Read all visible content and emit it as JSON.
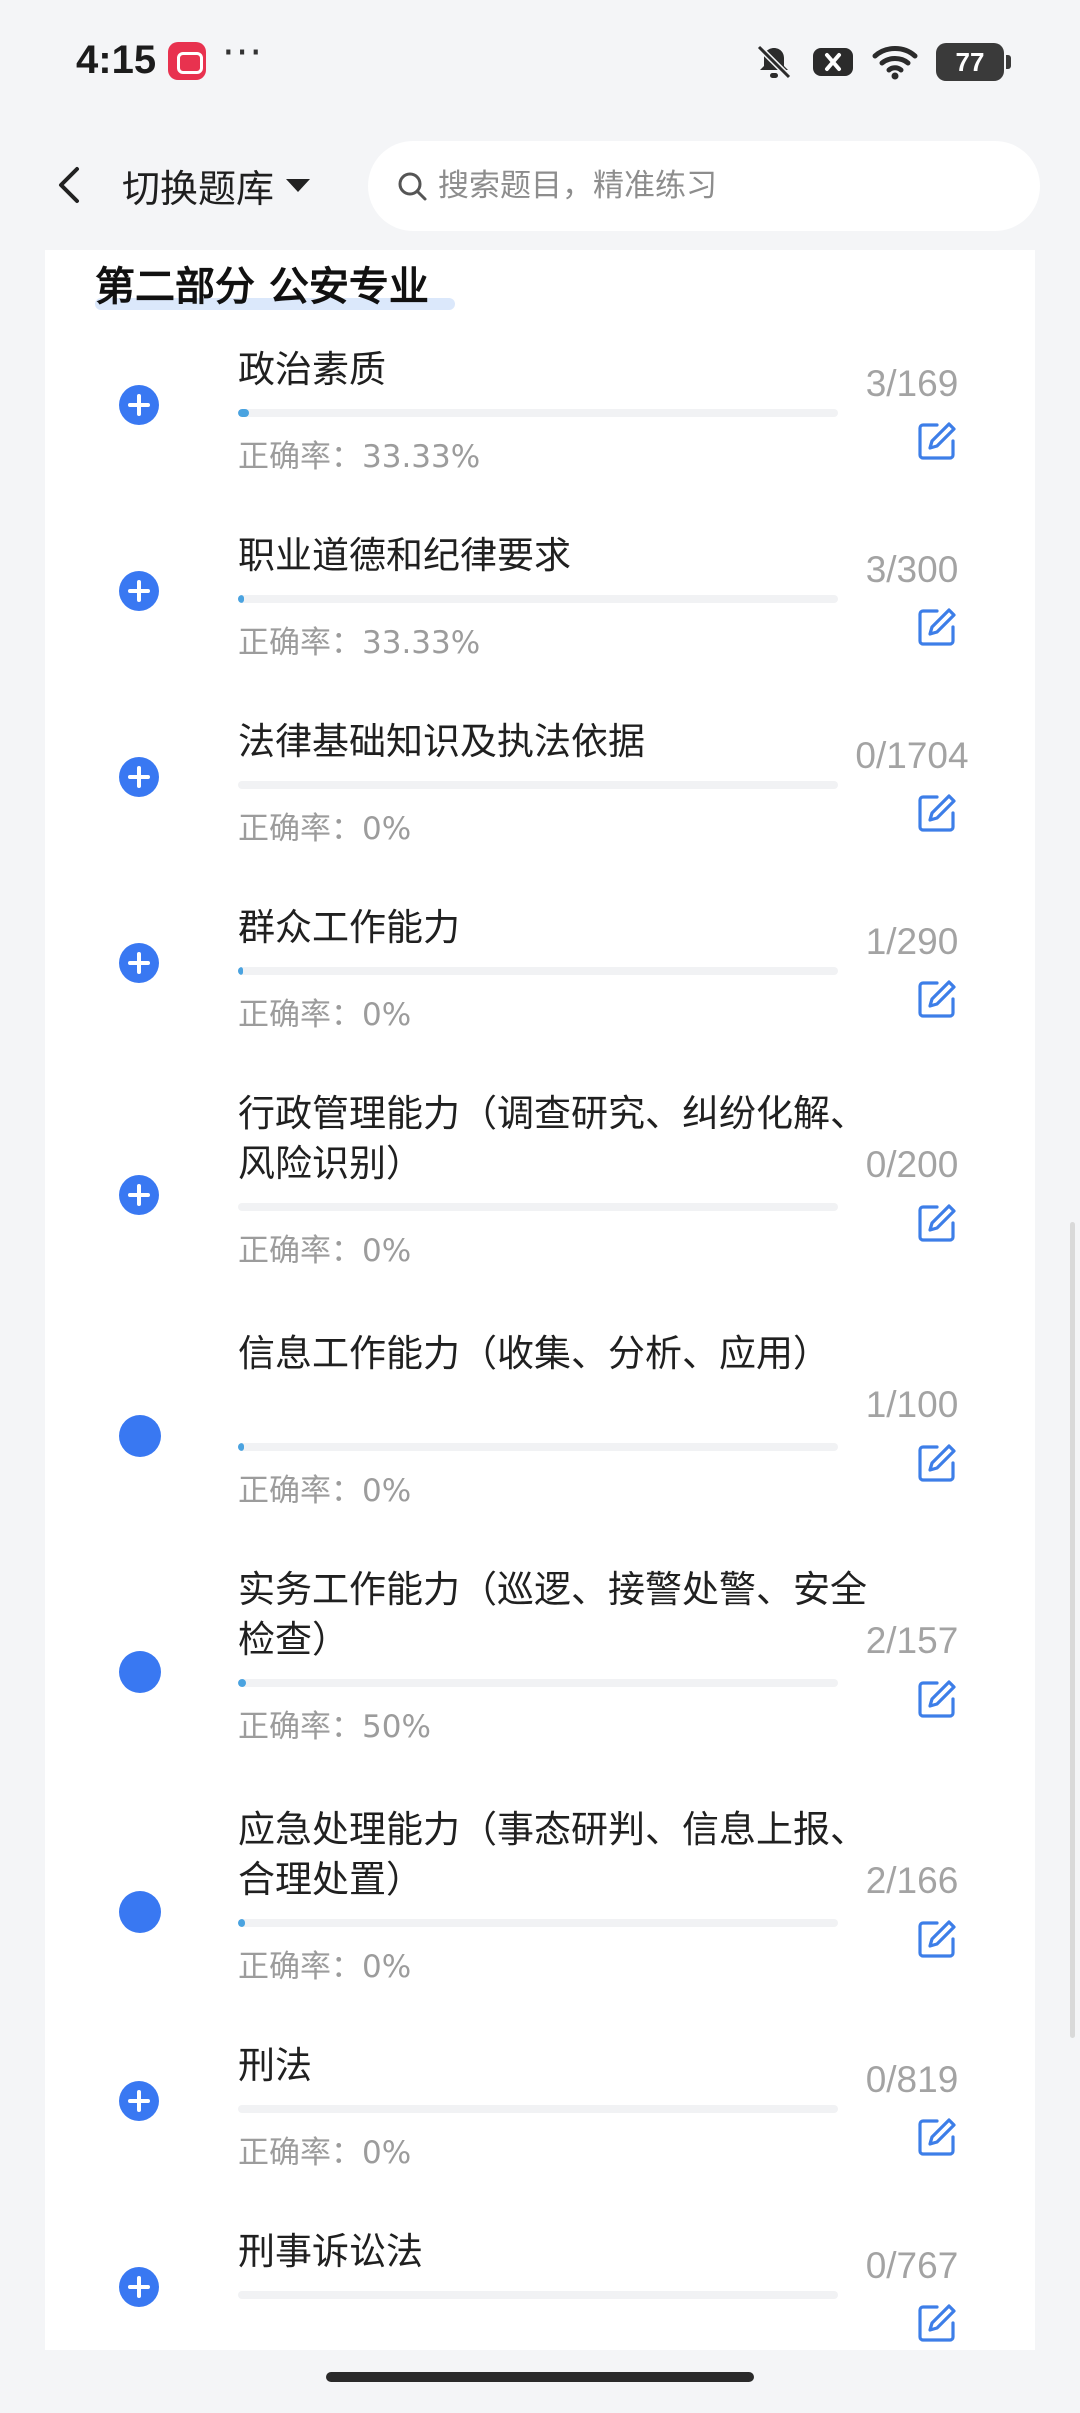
{
  "status_bar": {
    "time": "4:15",
    "dots": "···",
    "battery": "77"
  },
  "header": {
    "switch_label": "切换题库",
    "search_placeholder": "搜索题目，精准练习"
  },
  "section": {
    "title": "第二部分 公安专业"
  },
  "items": [
    {
      "title": "政治素质",
      "accuracy": "正确率：33.33%",
      "count": "3/169",
      "progress": 0.018,
      "icon": "plus-circle"
    },
    {
      "title": "职业道德和纪律要求",
      "accuracy": "正确率：33.33%",
      "count": "3/300",
      "progress": 0.01,
      "icon": "plus-circle"
    },
    {
      "title": "法律基础知识及执法依据",
      "accuracy": "正确率：0%",
      "count": "0/1704",
      "progress": 0,
      "icon": "plus-circle"
    },
    {
      "title": "群众工作能力",
      "accuracy": "正确率：0%",
      "count": "1/290",
      "progress": 0.003,
      "icon": "plus-circle"
    },
    {
      "title": "行政管理能力（调查研究、纠纷化解、风险识别）",
      "accuracy": "正确率：0%",
      "count": "0/200",
      "progress": 0,
      "icon": "plus-circle"
    },
    {
      "title": "信息工作能力（收集、分析、应用）",
      "accuracy": "正确率：0%",
      "count": "1/100",
      "progress": 0.01,
      "icon": "dot"
    },
    {
      "title": "实务工作能力（巡逻、接警处警、安全检查）",
      "accuracy": "正确率：50%",
      "count": "2/157",
      "progress": 0.013,
      "icon": "dot"
    },
    {
      "title": "应急处理能力（事态研判、信息上报、合理处置）",
      "accuracy": "正确率：0%",
      "count": "2/166",
      "progress": 0.012,
      "icon": "dot"
    },
    {
      "title": "刑法",
      "accuracy": "正确率：0%",
      "count": "0/819",
      "progress": 0,
      "icon": "plus-circle"
    },
    {
      "title": "刑事诉讼法",
      "accuracy": "",
      "count": "0/767",
      "progress": 0,
      "icon": "plus-circle"
    }
  ]
}
